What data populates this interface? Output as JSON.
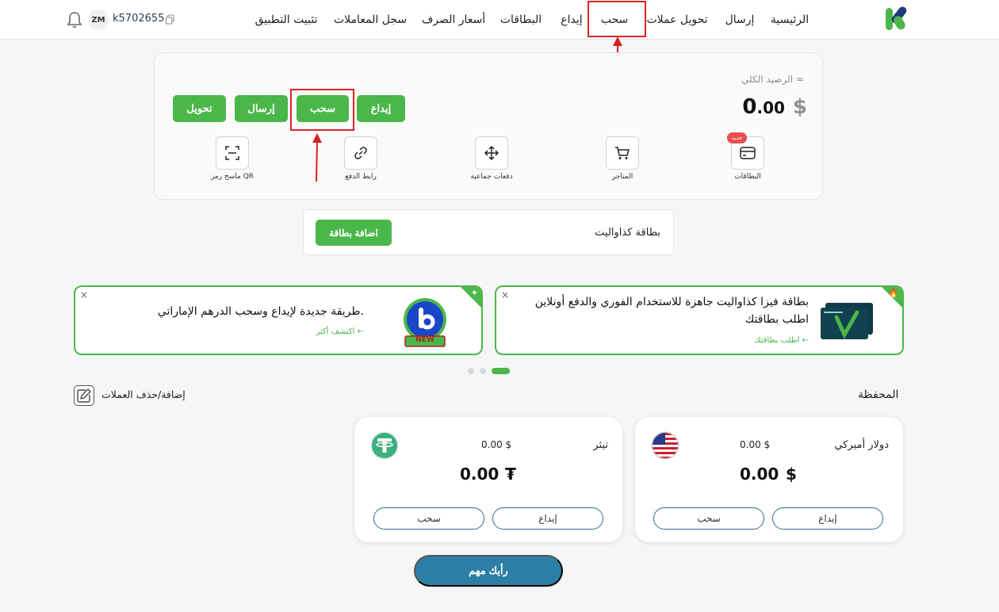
{
  "nav": {
    "items": [
      "الرئيسية",
      "إرسال",
      "تحويل عملات",
      "سحب",
      "إيداع",
      "البطاقات",
      "أسعار الصرف",
      "سجل المعاملات",
      "تثبيت التطبيق"
    ]
  },
  "user": {
    "initials": "ZM",
    "id": "k5702655"
  },
  "balance": {
    "label": "الرصيد الكلي ≈",
    "currency": "$",
    "whole": "0",
    "cents": ".00"
  },
  "actions": {
    "deposit": "إيداع",
    "withdraw": "سحب",
    "send": "إرسال",
    "convert": "تحويل"
  },
  "quick": {
    "cards": "البطاقات",
    "cards_badge": "جديد",
    "stores": "المتاجر",
    "bulk": "دفعات جماعية",
    "paylink": "رابط الدفع",
    "qr": "ماسح رمز QR"
  },
  "card_box": {
    "title": "بطاقة كذاواليت",
    "add_button": "اضافة بطاقة"
  },
  "promos": [
    {
      "title": "بطاقة فيزا كذاواليت جاهزة للاستخدام الفوري والدفع أونلاين اطلب بطاقتك",
      "link": "اطلب بطاقتك ←"
    },
    {
      "title": "طريقة جديدة لإيداع وسحب الدرهم الإماراتي.",
      "link": "اكتشف أكثر ←",
      "badge": "NEW"
    }
  ],
  "wallet": {
    "title": "المحفظة",
    "edit_label": "إضافة/حذف العملات",
    "currencies": [
      {
        "name": "دولار أميركي",
        "usd": "0.00 $",
        "amount": "0.00",
        "symbol": "$",
        "deposit": "إيداع",
        "withdraw": "سحب"
      },
      {
        "name": "تيثر",
        "usd": "0.00 $",
        "amount": "0.00",
        "symbol": "₮",
        "deposit": "إيداع",
        "withdraw": "سحب"
      }
    ]
  },
  "feedback": "رأيك مهم",
  "colors": {
    "brand_green": "#4bb74a",
    "feedback_blue": "#2d7fa6",
    "highlight_red": "#e02424"
  }
}
